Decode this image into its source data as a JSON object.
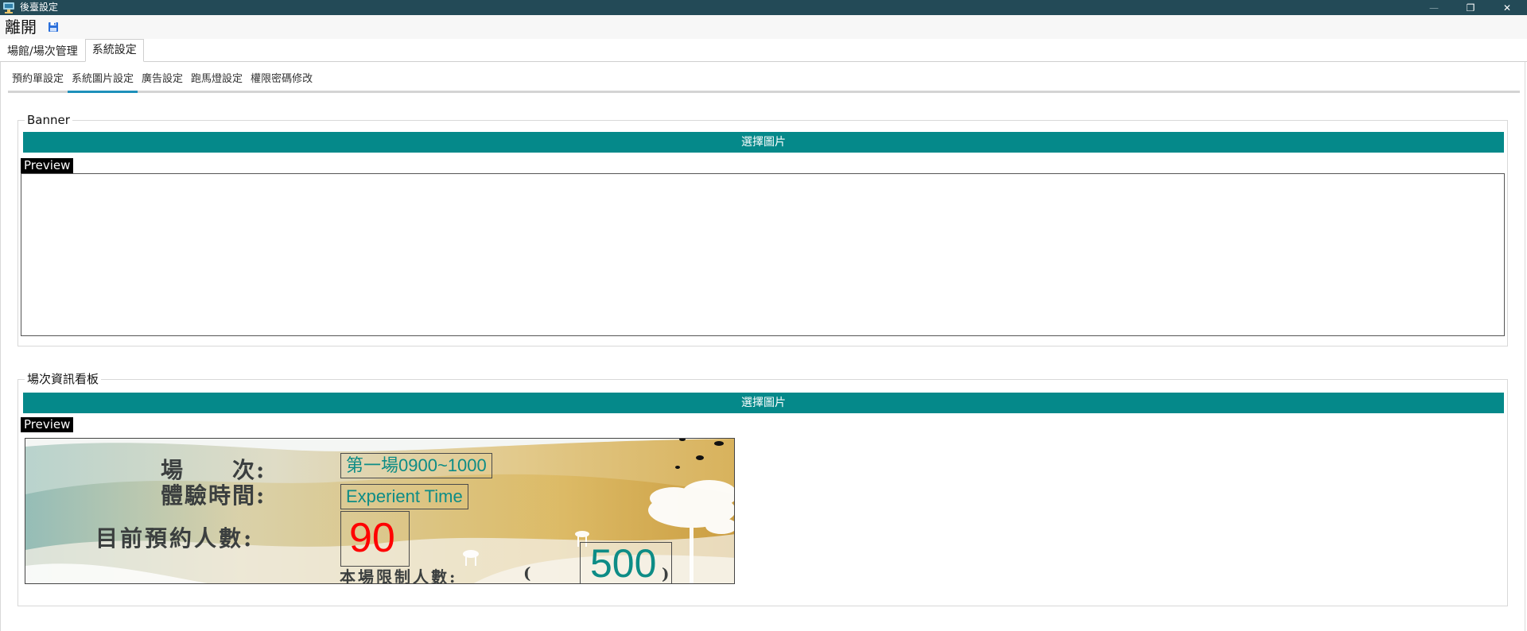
{
  "window": {
    "title": "後臺設定",
    "controls": {
      "minimize": "—",
      "maximize": "❐",
      "close": "✕"
    }
  },
  "menu": {
    "exit_label": "離開",
    "save_icon": "save-icon"
  },
  "outer_tabs": [
    {
      "label": "場館/場次管理",
      "active": false
    },
    {
      "label": "系統設定",
      "active": true
    }
  ],
  "inner_tabs": [
    {
      "label": "預約單設定",
      "active": false
    },
    {
      "label": "系統圖片設定",
      "active": true
    },
    {
      "label": "廣告設定",
      "active": false
    },
    {
      "label": "跑馬燈設定",
      "active": false
    },
    {
      "label": "權限密碼修改",
      "active": false
    }
  ],
  "banner_group": {
    "legend": "Banner",
    "select_label": "選擇圖片",
    "preview_label": "Preview"
  },
  "board_group": {
    "legend": "場次資訊看板",
    "select_label": "選擇圖片",
    "preview_label": "Preview",
    "board": {
      "session_label": "場　　次:",
      "time_label": "體驗時間:",
      "count_label": "目前預約人數:",
      "limit_label": "本場限制人數:",
      "paren_open": "(",
      "paren_close": ")",
      "session_value": "第一場0900~1000",
      "time_value": "Experient Time",
      "count_value": "90",
      "limit_value": "500"
    }
  },
  "colors": {
    "titlebar": "#234a57",
    "accent_button": "#05898a",
    "tab_indicator": "#1e90ba",
    "board_text_teal": "#0d8c86",
    "board_count_red": "#ff0000"
  }
}
